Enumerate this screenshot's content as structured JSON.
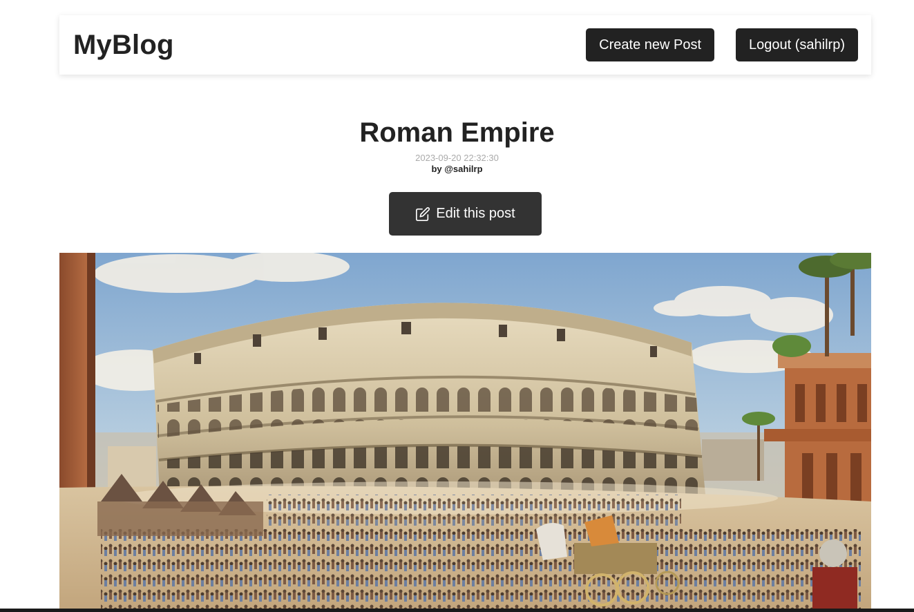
{
  "header": {
    "logo": "MyBlog",
    "create_label": "Create new Post",
    "logout_label": "Logout (sahilrp)"
  },
  "post": {
    "title": "Roman Empire",
    "time": "2023-09-20 22:32:30",
    "author": "by @sahilrp",
    "edit_label": "Edit this post",
    "edit_icon": "edit-icon",
    "image_subject": "colosseum-painting"
  },
  "colors": {
    "button_bg": "#222222",
    "edit_button_bg": "#333333",
    "button_text": "#ffffff",
    "time_text": "#aaaaaa"
  }
}
